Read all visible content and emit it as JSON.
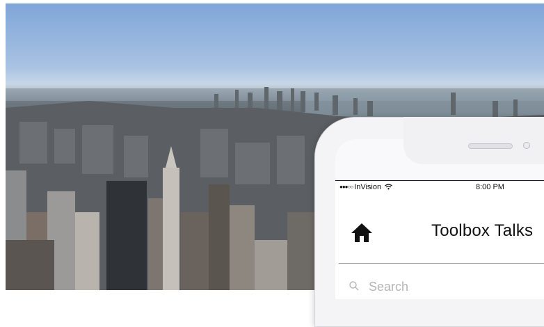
{
  "hero": {
    "alt": "city skyline"
  },
  "status_bar": {
    "signal": "●●●○○",
    "carrier": "InVision",
    "wifi_icon": "wifi-icon",
    "time": "8:00 PM"
  },
  "header": {
    "title": "Toolbox Talks",
    "home_icon": "home-icon"
  },
  "search": {
    "placeholder": "Search",
    "icon": "search-icon"
  }
}
